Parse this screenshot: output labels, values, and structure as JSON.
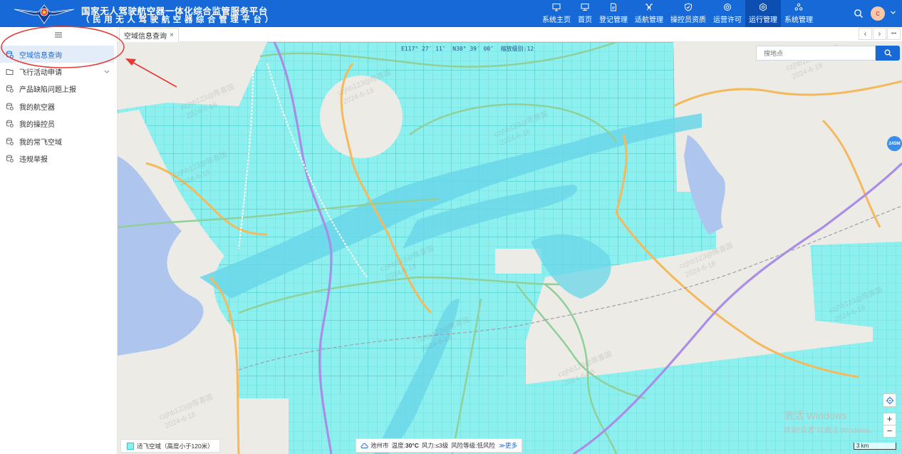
{
  "header": {
    "title_line1": "国家无人驾驶航空器一体化综合监管服务平台",
    "title_line2": "（民用无人驾驶航空器综合管理平台）",
    "nav": [
      {
        "label": "系统主页",
        "icon": "monitor-icon",
        "active": false
      },
      {
        "label": "首页",
        "icon": "desktop-icon",
        "active": false
      },
      {
        "label": "登记管理",
        "icon": "document-icon",
        "active": false
      },
      {
        "label": "适航管理",
        "icon": "drone-icon",
        "active": false
      },
      {
        "label": "操控员资质",
        "icon": "shield-icon",
        "active": false
      },
      {
        "label": "运营许可",
        "icon": "badge-icon",
        "active": false
      },
      {
        "label": "运行管理",
        "icon": "settings-hex-icon",
        "active": true
      },
      {
        "label": "系统管理",
        "icon": "cluster-icon",
        "active": false
      }
    ],
    "avatar_letter": "c"
  },
  "sidebar": {
    "items": [
      {
        "label": "空域信息查询",
        "active": true,
        "has_caret": false
      },
      {
        "label": "飞行活动申请",
        "active": false,
        "has_caret": true
      },
      {
        "label": "产品缺陷问题上报",
        "active": false,
        "has_caret": false
      },
      {
        "label": "我的航空器",
        "active": false,
        "has_caret": false
      },
      {
        "label": "我的操控员",
        "active": false,
        "has_caret": false
      },
      {
        "label": "我的常飞空域",
        "active": false,
        "has_caret": false
      },
      {
        "label": "违规举报",
        "active": false,
        "has_caret": false
      }
    ]
  },
  "tabs": {
    "open": [
      {
        "label": "空域信息查询",
        "close": "×"
      }
    ],
    "prev": "‹",
    "next": "›",
    "more": "•••"
  },
  "map": {
    "coords": "E117° 27′ 11″  N30° 39′ 00″  缩放级别:12",
    "search_placeholder": "搜地点",
    "side_badge": "245M",
    "zoom_in": "+",
    "zoom_out": "−",
    "scale": "3 km",
    "windows_watermark_title": "激活 Windows",
    "windows_watermark_sub": "转到“设置”以激活 Windows。",
    "user_watermark_name": "czjhb123@陈喜国",
    "user_watermark_date": "2024-6-18",
    "legend": {
      "label": "适飞空域（高度小于120米）",
      "color": "#8ef0ee"
    },
    "weather": {
      "city": "池州市",
      "temp_label": "温度:",
      "temp": "30°C",
      "wind_label": "风力:",
      "wind": "≤3级",
      "risk_label": "风险等级:",
      "risk": "低风险",
      "more": "≫更多"
    }
  },
  "colors": {
    "header_bg": "#1769d8",
    "nav_active_bg": "#0d4fb0",
    "sidebar_active_bg": "#e3ecf9",
    "airspace_fill": "#8ef0ee",
    "water": "#aec6ee",
    "highway_purple": "#a98de8",
    "road_orange": "#f4b95c",
    "road_green": "#8fd09a",
    "annotation_red": "#e53935"
  }
}
